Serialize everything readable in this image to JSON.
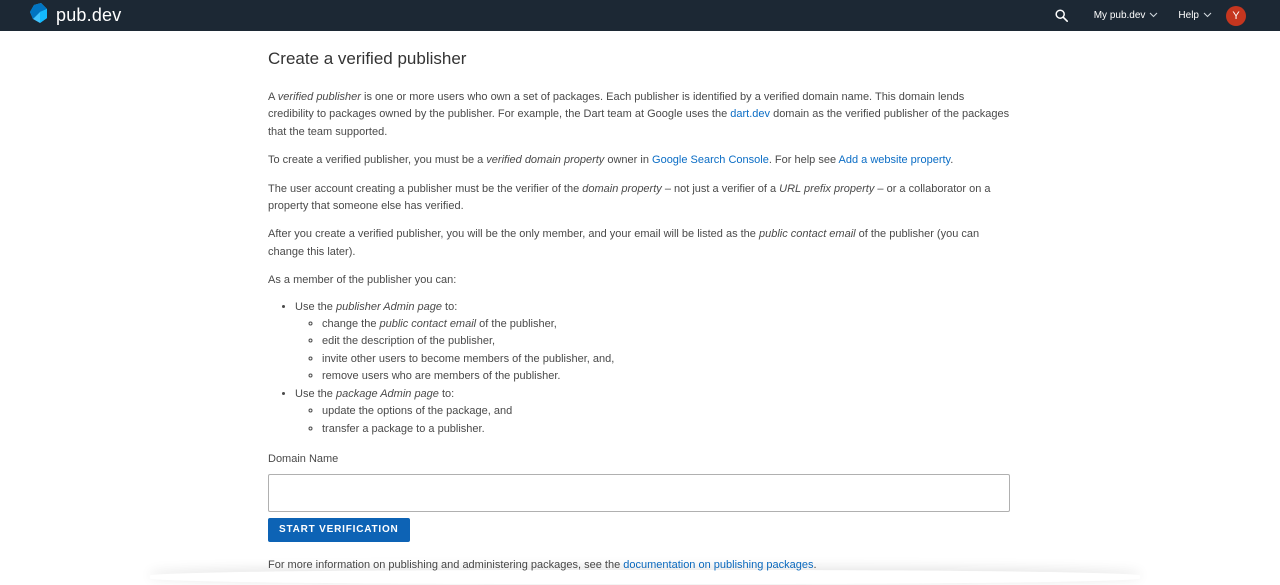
{
  "header": {
    "logo_text": "pub.dev",
    "my_pub_label": "My pub.dev",
    "help_label": "Help",
    "avatar_letter": "Y",
    "avatar_color": "#c5361f",
    "bar_color": "#1c2834"
  },
  "page": {
    "title": "Create a verified publisher",
    "p1": {
      "a": "A ",
      "em1": "verified publisher",
      "b": " is one or more users who own a set of packages. Each publisher is identified by a verified domain name. This domain lends credibility to packages owned by the publisher. For example, the Dart team at Google uses the ",
      "link": "dart.dev",
      "c": " domain as the verified publisher of the packages that the team supported."
    },
    "p2": {
      "a": "To create a verified publisher, you must be a ",
      "em1": "verified domain property",
      "b": " owner in ",
      "link1": "Google Search Console",
      "c": ". For help see ",
      "link2": "Add a website property",
      "d": "."
    },
    "p3": {
      "a": "The user account creating a publisher must be the verifier of the ",
      "em1": "domain property",
      "b": " – not just a verifier of a ",
      "em2": "URL prefix property",
      "c": " – or a collaborator on a property that someone else has verified."
    },
    "p4": {
      "a": "After you create a verified publisher, you will be the only member, and your email will be listed as the ",
      "em1": "public contact email",
      "b": " of the publisher (you can change this later)."
    },
    "p5": "As a member of the publisher you can:",
    "list": {
      "item1": {
        "a": "Use the ",
        "em": "publisher Admin page",
        "b": " to:",
        "sub1a": "change the ",
        "sub1em": "public contact email",
        "sub1b": " of the publisher,",
        "sub2": "edit the description of the publisher,",
        "sub3": "invite other users to become members of the publisher, and,",
        "sub4": "remove users who are members of the publisher."
      },
      "item2": {
        "a": "Use the ",
        "em": "package Admin page",
        "b": " to:",
        "sub1": "update the options of the package, and",
        "sub2": "transfer a package to a publisher."
      }
    },
    "form": {
      "label": "Domain Name",
      "value": "",
      "button": "START VERIFICATION",
      "button_color": "#0d63b5"
    },
    "footer": {
      "a": "For more information on publishing and administering packages, see the ",
      "link": "documentation on publishing packages",
      "b": "."
    },
    "link_color": "#0b6dc5"
  }
}
